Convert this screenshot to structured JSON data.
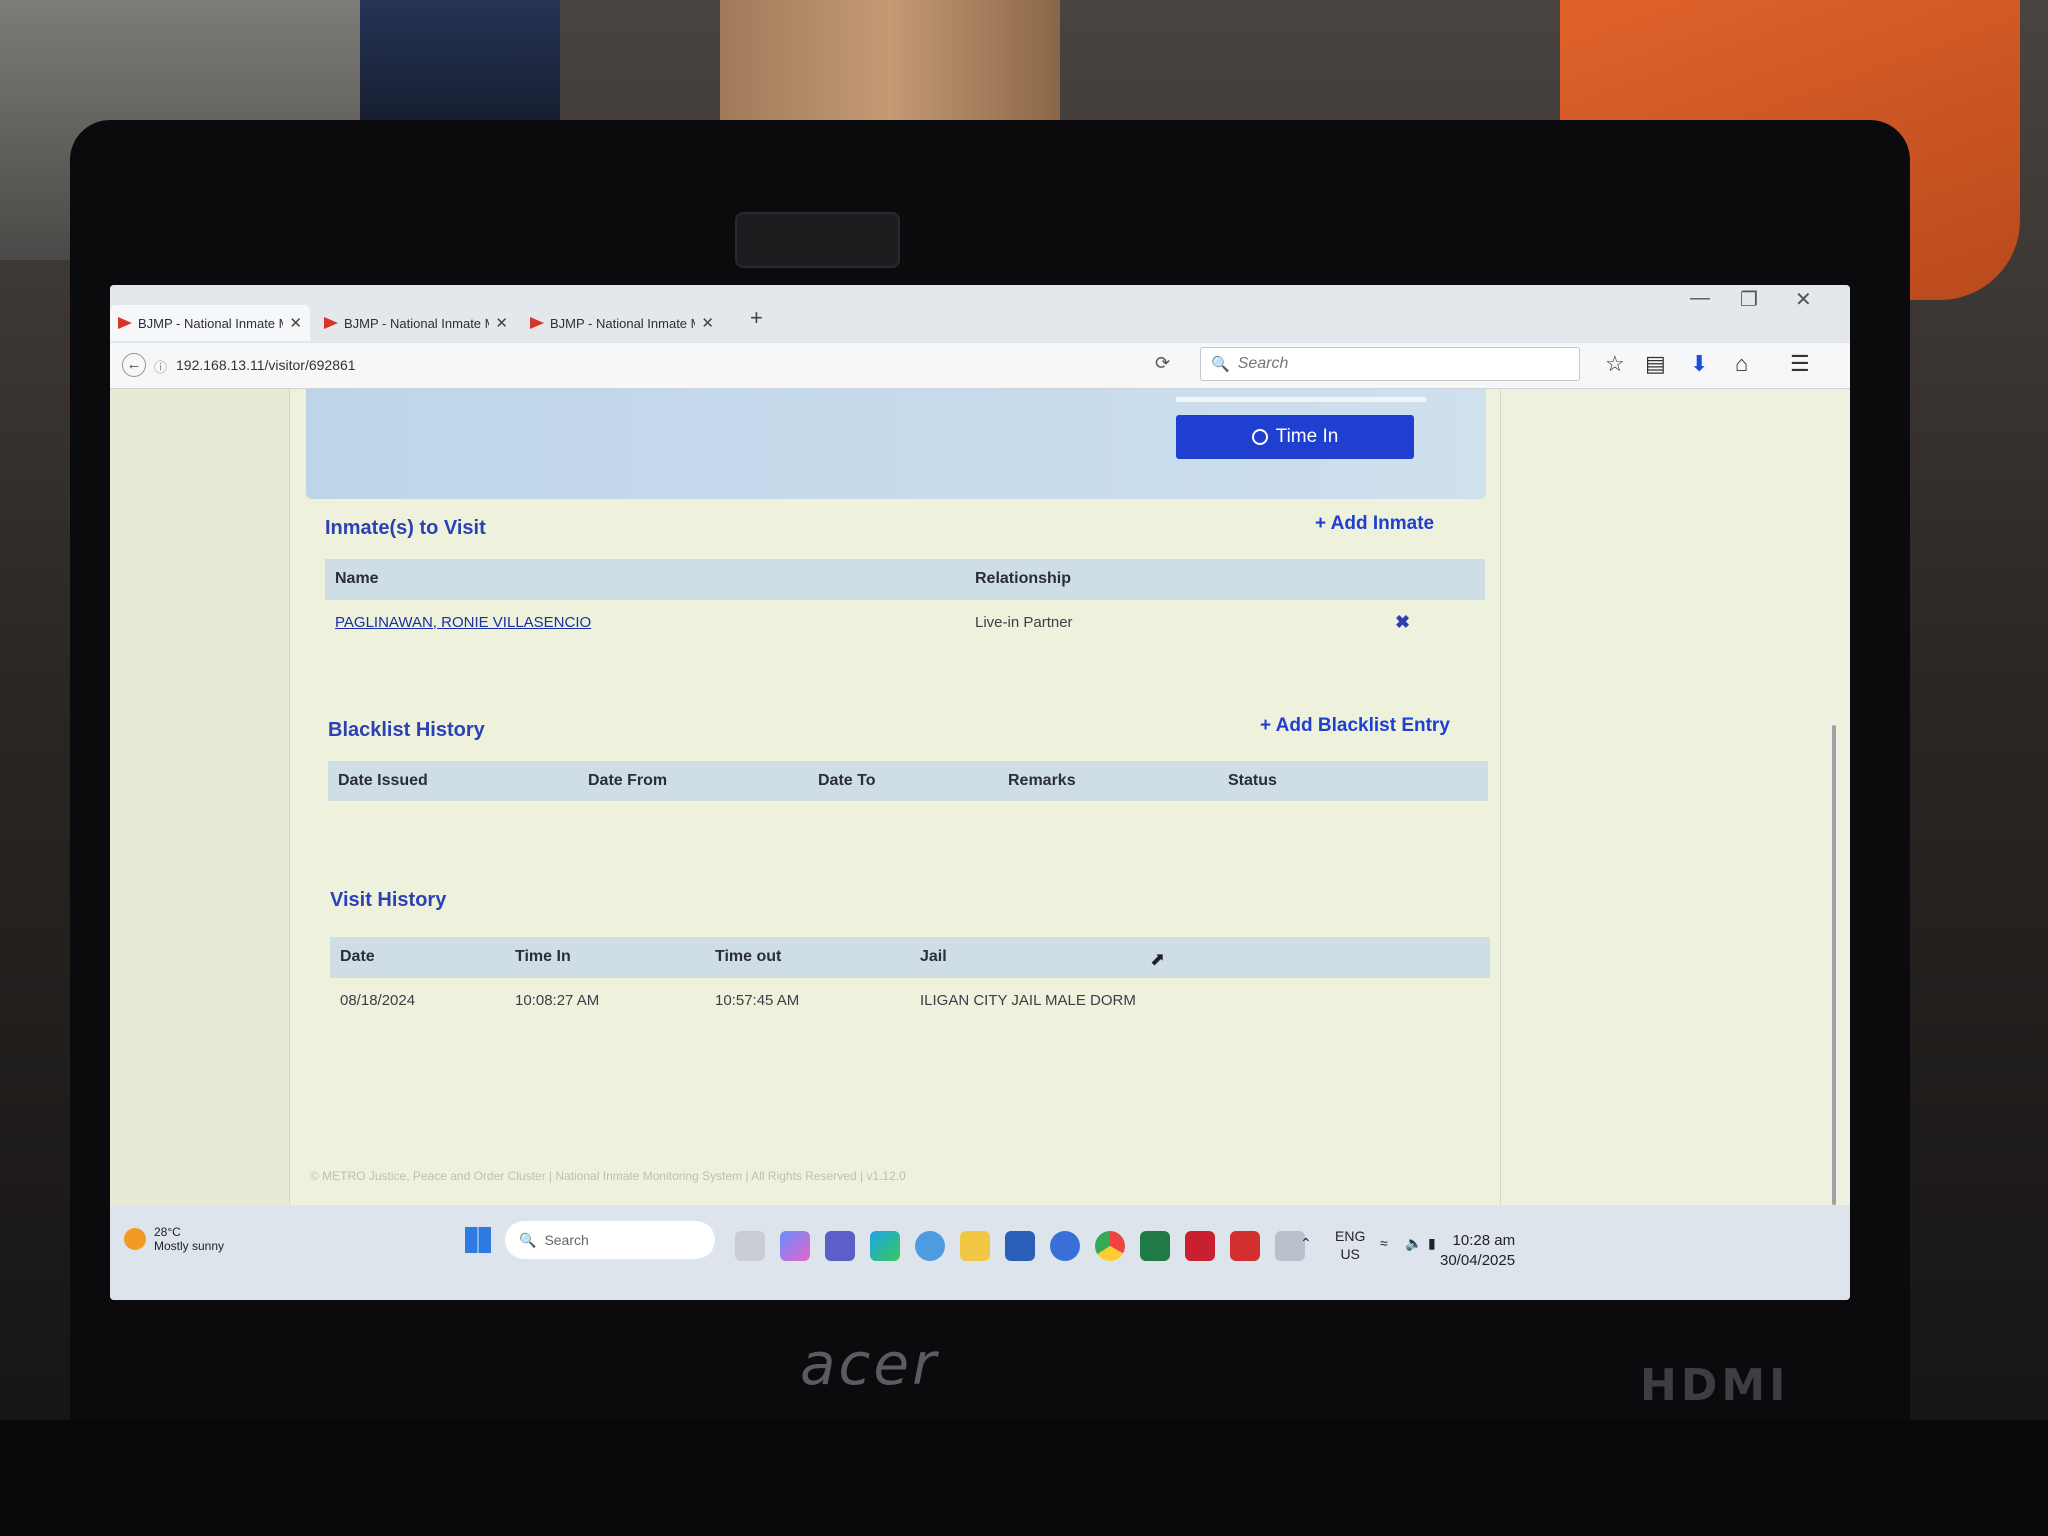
{
  "browser": {
    "tabs": [
      {
        "label": "BJMP - National Inmate M..."
      },
      {
        "label": "BJMP - National Inmate M..."
      },
      {
        "label": "BJMP - National Inmate M..."
      }
    ],
    "new_tab": "+",
    "close_glyph": "✕",
    "url": "192.168.13.11/visitor/692861",
    "search_placeholder": "Search"
  },
  "page": {
    "time_in_label": "Time In",
    "inmates": {
      "title": "Inmate(s) to Visit",
      "add_label": "+ Add Inmate",
      "columns": [
        "Name",
        "Relationship",
        ""
      ],
      "rows": [
        {
          "name": "PAGLINAWAN, RONIE VILLASENCIO",
          "relationship": "Live-in Partner"
        }
      ],
      "remove_glyph": "✖"
    },
    "blacklist": {
      "title": "Blacklist History",
      "add_label": "+ Add Blacklist Entry",
      "columns": [
        "Date Issued",
        "Date From",
        "Date To",
        "Remarks",
        "Status"
      ]
    },
    "visits": {
      "title": "Visit History",
      "columns": [
        "Date",
        "Time In",
        "Time out",
        "Jail"
      ],
      "rows": [
        {
          "date": "08/18/2024",
          "time_in": "10:08:27 AM",
          "time_out": "10:57:45 AM",
          "jail": "ILIGAN CITY JAIL MALE DORM"
        }
      ]
    },
    "footer": "© METRO Justice, Peace and Order Cluster  |  National Inmate Monitoring System  |  All Rights Reserved  |  v1.12.0"
  },
  "taskbar": {
    "weather_temp": "28°C",
    "weather_desc": "Mostly sunny",
    "search_placeholder": "Search",
    "lang_top": "ENG",
    "lang_bottom": "US",
    "time": "10:28 am",
    "date": "30/04/2025"
  },
  "hardware": {
    "brand": "acer",
    "port_label": "HDMI"
  },
  "colors": {
    "accent": "#1f3fd1",
    "header_bg": "#cfdde7",
    "page_bg": "#eef2dd"
  }
}
